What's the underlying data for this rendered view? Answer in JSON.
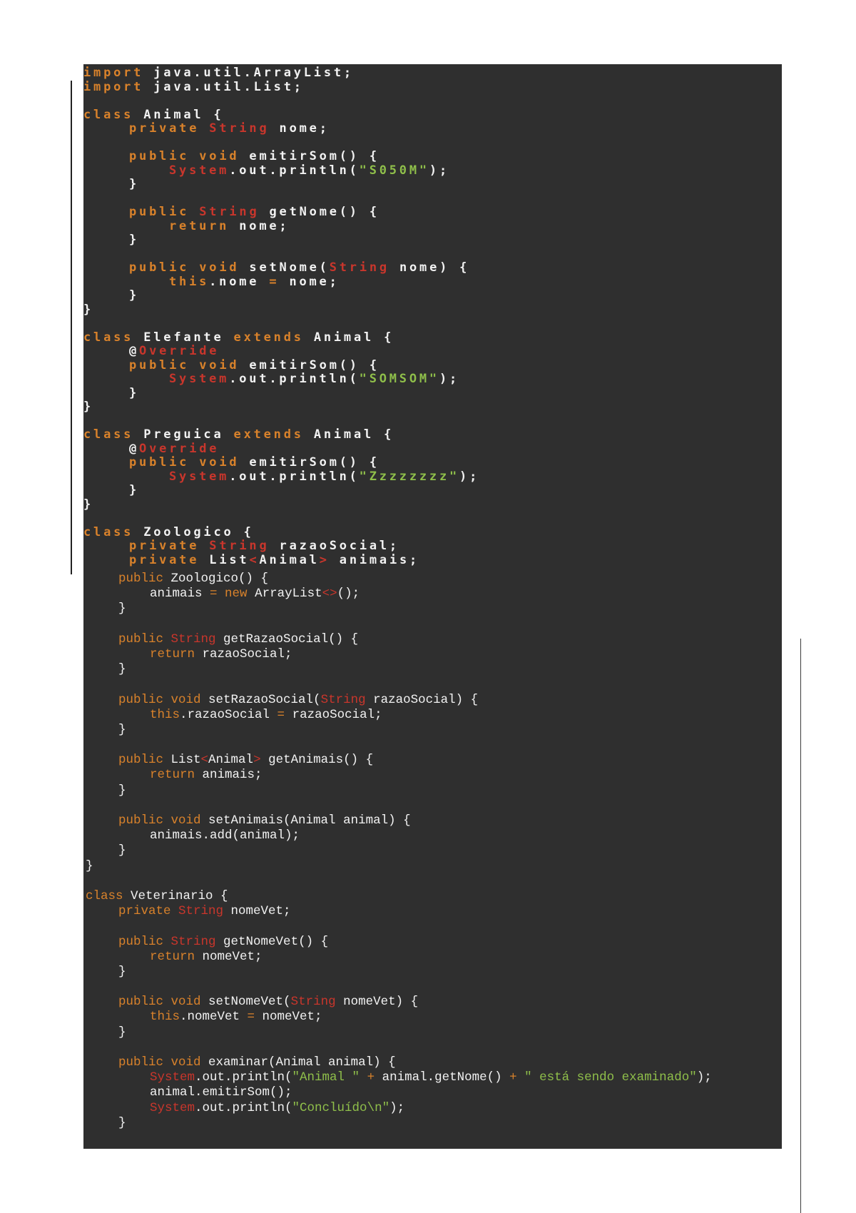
{
  "code": {
    "section1": [
      {
        "i": 0,
        "t": [
          [
            "import",
            "k"
          ],
          [
            " java.util.ArrayList;",
            "p"
          ]
        ]
      },
      {
        "i": 0,
        "t": [
          [
            "import",
            "k"
          ],
          [
            " java.util.List;",
            "p"
          ]
        ]
      },
      {
        "i": 0,
        "t": []
      },
      {
        "i": 0,
        "t": [
          [
            "class",
            "k"
          ],
          [
            " Animal {",
            "p"
          ]
        ]
      },
      {
        "i": 1,
        "t": [
          [
            "private",
            "k"
          ],
          [
            " ",
            "p"
          ],
          [
            "String",
            "t"
          ],
          [
            " nome;",
            "p"
          ]
        ]
      },
      {
        "i": 0,
        "t": []
      },
      {
        "i": 1,
        "t": [
          [
            "public void",
            "k"
          ],
          [
            " emitirSom() {",
            "p"
          ]
        ]
      },
      {
        "i": 2,
        "t": [
          [
            "System",
            "t"
          ],
          [
            ".out.println(",
            "p"
          ],
          [
            "\"S050M\"",
            "s"
          ],
          [
            ");",
            "p"
          ]
        ]
      },
      {
        "i": 1,
        "t": [
          [
            "}",
            "p"
          ]
        ]
      },
      {
        "i": 0,
        "t": []
      },
      {
        "i": 1,
        "t": [
          [
            "public",
            "k"
          ],
          [
            " ",
            "p"
          ],
          [
            "String",
            "t"
          ],
          [
            " getNome() {",
            "p"
          ]
        ]
      },
      {
        "i": 2,
        "t": [
          [
            "return",
            "k"
          ],
          [
            " nome;",
            "p"
          ]
        ]
      },
      {
        "i": 1,
        "t": [
          [
            "}",
            "p"
          ]
        ]
      },
      {
        "i": 0,
        "t": []
      },
      {
        "i": 1,
        "t": [
          [
            "public void",
            "k"
          ],
          [
            " setNome(",
            "p"
          ],
          [
            "String",
            "t"
          ],
          [
            " nome) {",
            "p"
          ]
        ]
      },
      {
        "i": 2,
        "t": [
          [
            "this",
            "k"
          ],
          [
            ".nome ",
            "p"
          ],
          [
            "=",
            "k"
          ],
          [
            " nome;",
            "p"
          ]
        ]
      },
      {
        "i": 1,
        "t": [
          [
            "}",
            "p"
          ]
        ]
      },
      {
        "i": 0,
        "t": [
          [
            "}",
            "p"
          ]
        ]
      },
      {
        "i": 0,
        "t": []
      },
      {
        "i": 0,
        "t": [
          [
            "class",
            "k"
          ],
          [
            " Elefante ",
            "p"
          ],
          [
            "extends",
            "k"
          ],
          [
            " Animal {",
            "p"
          ]
        ]
      },
      {
        "i": 1,
        "t": [
          [
            "@",
            "p"
          ],
          [
            "Override",
            "t"
          ]
        ]
      },
      {
        "i": 1,
        "t": [
          [
            "public void",
            "k"
          ],
          [
            " emitirSom() {",
            "p"
          ]
        ]
      },
      {
        "i": 2,
        "t": [
          [
            "System",
            "t"
          ],
          [
            ".out.println(",
            "p"
          ],
          [
            "\"SOMSOM\"",
            "s"
          ],
          [
            ");",
            "p"
          ]
        ]
      },
      {
        "i": 1,
        "t": [
          [
            "}",
            "p"
          ]
        ]
      },
      {
        "i": 0,
        "t": [
          [
            "}",
            "p"
          ]
        ]
      },
      {
        "i": 0,
        "t": []
      },
      {
        "i": 0,
        "t": [
          [
            "class",
            "k"
          ],
          [
            " Preguica ",
            "p"
          ],
          [
            "extends",
            "k"
          ],
          [
            " Animal {",
            "p"
          ]
        ]
      },
      {
        "i": 1,
        "t": [
          [
            "@",
            "p"
          ],
          [
            "Override",
            "t"
          ]
        ]
      },
      {
        "i": 1,
        "t": [
          [
            "public void",
            "k"
          ],
          [
            " emitirSom() {",
            "p"
          ]
        ]
      },
      {
        "i": 2,
        "t": [
          [
            "System",
            "t"
          ],
          [
            ".out.println(",
            "p"
          ],
          [
            "\"Zzzzzzzz\"",
            "s"
          ],
          [
            ");",
            "p"
          ]
        ]
      },
      {
        "i": 1,
        "t": [
          [
            "}",
            "p"
          ]
        ]
      },
      {
        "i": 0,
        "t": [
          [
            "}",
            "p"
          ]
        ]
      },
      {
        "i": 0,
        "t": []
      },
      {
        "i": 0,
        "t": [
          [
            "class",
            "k"
          ],
          [
            " Zoologico {",
            "p"
          ]
        ]
      },
      {
        "i": 1,
        "t": [
          [
            "private",
            "k"
          ],
          [
            " ",
            "p"
          ],
          [
            "String",
            "t"
          ],
          [
            " razaoSocial;",
            "p"
          ]
        ]
      },
      {
        "i": 1,
        "t": [
          [
            "private",
            "k"
          ],
          [
            " List",
            "p"
          ],
          [
            "<",
            "t"
          ],
          [
            "Animal",
            "p"
          ],
          [
            ">",
            "t"
          ],
          [
            " animais;",
            "p"
          ]
        ]
      }
    ],
    "section2": [
      {
        "i": 1,
        "t": [
          [
            "public",
            "k"
          ],
          [
            " Zoologico() {",
            "p"
          ]
        ]
      },
      {
        "i": 2,
        "t": [
          [
            "animais ",
            "p"
          ],
          [
            "=",
            "k"
          ],
          [
            " ",
            "p"
          ],
          [
            "new",
            "k"
          ],
          [
            " ArrayList",
            "p"
          ],
          [
            "<>",
            "t"
          ],
          [
            "();",
            "p"
          ]
        ]
      },
      {
        "i": 1,
        "t": [
          [
            "}",
            "p"
          ]
        ]
      },
      {
        "i": 0,
        "t": []
      },
      {
        "i": 1,
        "t": [
          [
            "public",
            "k"
          ],
          [
            " ",
            "p"
          ],
          [
            "String",
            "t"
          ],
          [
            " getRazaoSocial() {",
            "p"
          ]
        ]
      },
      {
        "i": 2,
        "t": [
          [
            "return",
            "k"
          ],
          [
            " razaoSocial;",
            "p"
          ]
        ]
      },
      {
        "i": 1,
        "t": [
          [
            "}",
            "p"
          ]
        ]
      },
      {
        "i": 0,
        "t": []
      },
      {
        "i": 1,
        "t": [
          [
            "public void",
            "k"
          ],
          [
            " setRazaoSocial(",
            "p"
          ],
          [
            "String",
            "t"
          ],
          [
            " razaoSocial) {",
            "p"
          ]
        ]
      },
      {
        "i": 2,
        "t": [
          [
            "this",
            "k"
          ],
          [
            ".razaoSocial ",
            "p"
          ],
          [
            "=",
            "k"
          ],
          [
            " razaoSocial;",
            "p"
          ]
        ]
      },
      {
        "i": 1,
        "t": [
          [
            "}",
            "p"
          ]
        ]
      },
      {
        "i": 0,
        "t": []
      },
      {
        "i": 1,
        "t": [
          [
            "public",
            "k"
          ],
          [
            " List",
            "p"
          ],
          [
            "<",
            "t"
          ],
          [
            "Animal",
            "p"
          ],
          [
            ">",
            "t"
          ],
          [
            " getAnimais() {",
            "p"
          ]
        ]
      },
      {
        "i": 2,
        "t": [
          [
            "return",
            "k"
          ],
          [
            " animais;",
            "p"
          ]
        ]
      },
      {
        "i": 1,
        "t": [
          [
            "}",
            "p"
          ]
        ]
      },
      {
        "i": 0,
        "t": []
      },
      {
        "i": 1,
        "t": [
          [
            "public void",
            "k"
          ],
          [
            " setAnimais(Animal animal) {",
            "p"
          ]
        ]
      },
      {
        "i": 2,
        "t": [
          [
            "animais.add(animal);",
            "p"
          ]
        ]
      },
      {
        "i": 1,
        "t": [
          [
            "}",
            "p"
          ]
        ]
      },
      {
        "i": 0,
        "t": [
          [
            "}",
            "p"
          ]
        ]
      },
      {
        "i": 0,
        "t": []
      },
      {
        "i": 0,
        "t": [
          [
            "class",
            "k"
          ],
          [
            " Veterinario {",
            "p"
          ]
        ]
      },
      {
        "i": 1,
        "t": [
          [
            "private",
            "k"
          ],
          [
            " ",
            "p"
          ],
          [
            "String",
            "t"
          ],
          [
            " nomeVet;",
            "p"
          ]
        ]
      },
      {
        "i": 0,
        "t": []
      },
      {
        "i": 1,
        "t": [
          [
            "public",
            "k"
          ],
          [
            " ",
            "p"
          ],
          [
            "String",
            "t"
          ],
          [
            " getNomeVet() {",
            "p"
          ]
        ]
      },
      {
        "i": 2,
        "t": [
          [
            "return",
            "k"
          ],
          [
            " nomeVet;",
            "p"
          ]
        ]
      },
      {
        "i": 1,
        "t": [
          [
            "}",
            "p"
          ]
        ]
      },
      {
        "i": 0,
        "t": []
      },
      {
        "i": 1,
        "t": [
          [
            "public void",
            "k"
          ],
          [
            " setNomeVet(",
            "p"
          ],
          [
            "String",
            "t"
          ],
          [
            " nomeVet) {",
            "p"
          ]
        ]
      },
      {
        "i": 2,
        "t": [
          [
            "this",
            "k"
          ],
          [
            ".nomeVet ",
            "p"
          ],
          [
            "=",
            "k"
          ],
          [
            " nomeVet;",
            "p"
          ]
        ]
      },
      {
        "i": 1,
        "t": [
          [
            "}",
            "p"
          ]
        ]
      },
      {
        "i": 0,
        "t": []
      },
      {
        "i": 1,
        "t": [
          [
            "public void",
            "k"
          ],
          [
            " examinar(Animal animal) {",
            "p"
          ]
        ]
      },
      {
        "i": 2,
        "t": [
          [
            "System",
            "t"
          ],
          [
            ".out.println(",
            "p"
          ],
          [
            "\"Animal \"",
            "s"
          ],
          [
            " ",
            "p"
          ],
          [
            "+",
            "k"
          ],
          [
            " animal.getNome() ",
            "p"
          ],
          [
            "+",
            "k"
          ],
          [
            " ",
            "p"
          ],
          [
            "\" está sendo examinado\"",
            "s"
          ],
          [
            ");",
            "p"
          ]
        ]
      },
      {
        "i": 2,
        "t": [
          [
            "animal.emitirSom();",
            "p"
          ]
        ]
      },
      {
        "i": 2,
        "t": [
          [
            "System",
            "t"
          ],
          [
            ".out.println(",
            "p"
          ],
          [
            "\"Concluído\\n\"",
            "s"
          ],
          [
            ");",
            "p"
          ]
        ]
      },
      {
        "i": 1,
        "t": [
          [
            "}",
            "p"
          ]
        ]
      }
    ]
  }
}
